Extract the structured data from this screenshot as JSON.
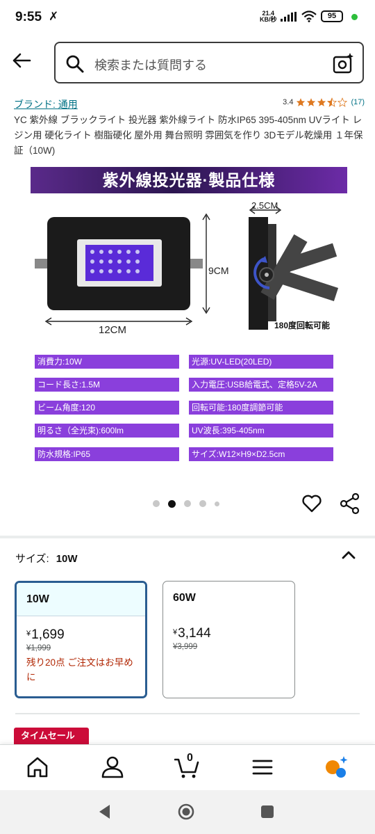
{
  "status_bar": {
    "time": "9:55",
    "extra_icon": "✗",
    "net_speed_value": "21.4",
    "net_speed_unit": "KB/秒",
    "battery": "95"
  },
  "search": {
    "placeholder": "検索または質問する"
  },
  "product": {
    "brand": "ブランド: 通用",
    "rating_value": "3.4",
    "rating_stars": 3.4,
    "rating_count": "(17)",
    "title": "YC 紫外線 ブラックライト 投光器 紫外線ライト 防水IP65 395-405nm UVライト レジン用 硬化ライト 樹脂硬化 屋外用 舞台照明 雰囲気を作り 3Dモデル乾燥用 １年保証（10W)"
  },
  "product_image": {
    "banner": "紫外線投光器·製品仕様",
    "dims": {
      "depth": "2.5CM",
      "height": "9CM",
      "width": "12CM",
      "rotate": "180度回転可能"
    },
    "specs_left": [
      "消費力:10W",
      "コード長さ:1.5M",
      "ビーム角度:120",
      "明るさ（全光束):600lm",
      "防水規格:IP65"
    ],
    "specs_right": [
      "光源:UV-LED(20LED)",
      "入力電圧:USB給電式、定格5V-2A",
      "回転可能:180度調節可能",
      "UV波長:395-405nm",
      "サイズ:W12×H9×D2.5cm"
    ]
  },
  "carousel": {
    "count": 5,
    "active_index": 1
  },
  "size_selector": {
    "label": "サイズ:",
    "selected": "10W",
    "options": [
      {
        "name": "10W",
        "currency": "¥",
        "price": "1,699",
        "list_price": "¥1,999",
        "note": "残り20点 ご注文はお早めに"
      },
      {
        "name": "60W",
        "currency": "¥",
        "price": "3,144",
        "list_price": "¥3,999",
        "note": ""
      }
    ]
  },
  "badge": {
    "timesale": "タイムセール"
  },
  "bottom_nav": {
    "items": [
      "home-icon",
      "account-icon",
      "cart-icon",
      "menu-icon",
      "rufus-icon"
    ],
    "cart_count": "0"
  },
  "colors": {
    "link": "#007185",
    "star": "#de7921",
    "price_alert": "#b12704",
    "selected_border": "#2a5d91",
    "spec_label": "#8a3fdc",
    "timesale": "#cc0c39"
  }
}
